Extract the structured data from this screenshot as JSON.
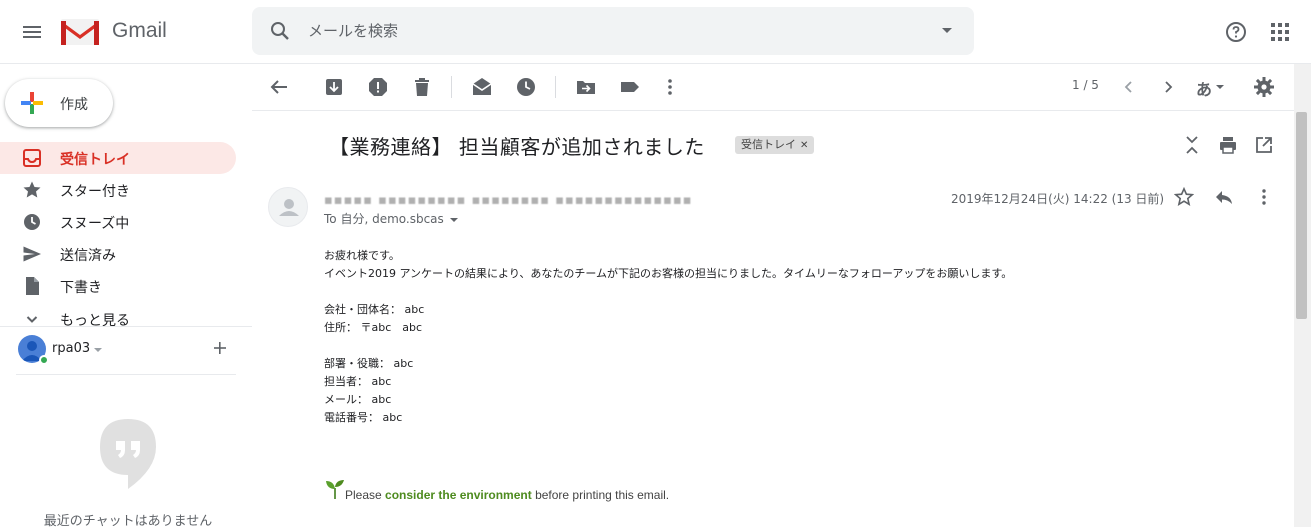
{
  "header": {
    "brand": "Gmail",
    "search_placeholder": "メールを検索",
    "icons": [
      "hamburger-icon",
      "gmail-logo",
      "search-icon",
      "search-options-icon",
      "help-icon",
      "apps-icon"
    ]
  },
  "sidebar": {
    "compose_label": "作成",
    "items": [
      {
        "label": "受信トレイ",
        "icon": "inbox-icon",
        "active": true
      },
      {
        "label": "スター付き",
        "icon": "star-icon",
        "active": false
      },
      {
        "label": "スヌーズ中",
        "icon": "clock-icon",
        "active": false
      },
      {
        "label": "送信済み",
        "icon": "send-icon",
        "active": false
      },
      {
        "label": "下書き",
        "icon": "draft-icon",
        "active": false
      },
      {
        "label": "もっと見る",
        "icon": "chevron-down-icon",
        "active": false
      }
    ],
    "account": {
      "name": "rpa03"
    },
    "no_chat_text": "最近のチャットはありません"
  },
  "toolbar": {
    "pager": "1 / 5",
    "language": "あ"
  },
  "message": {
    "subject": "【業務連絡】 担当顧客が追加されました",
    "label": "受信トレイ",
    "sender_redacted": "▪▪▪▪▪  ▪▪▪▪▪▪▪▪▪ ▪▪▪▪▪▪▪▪  ▪▪▪▪▪▪▪▪▪▪▪▪▪▪",
    "to": "To 自分, demo.sbcas",
    "date": "2019年12月24日(火) 14:22 (13 日前)",
    "body": {
      "greeting": "お疲れ様です。",
      "intro": "イベント2019 アンケートの結果により、あなたのチームが下記のお客様の担当にりました。タイムリーなフォローアップをお願いします。",
      "company": "会社・団体名： abc",
      "address": "住所： 〒abc　abc",
      "department": "部署・役職： abc",
      "person": "担当者： abc",
      "mail": "メール： abc",
      "phone": "電話番号： abc"
    },
    "footer": {
      "prefix": "Please ",
      "highlight": "consider the environment",
      "suffix": " before printing this email."
    }
  },
  "colors": {
    "active_red": "#d93025",
    "active_bg": "#fce8e6",
    "env_green": "#4e8b1f"
  }
}
